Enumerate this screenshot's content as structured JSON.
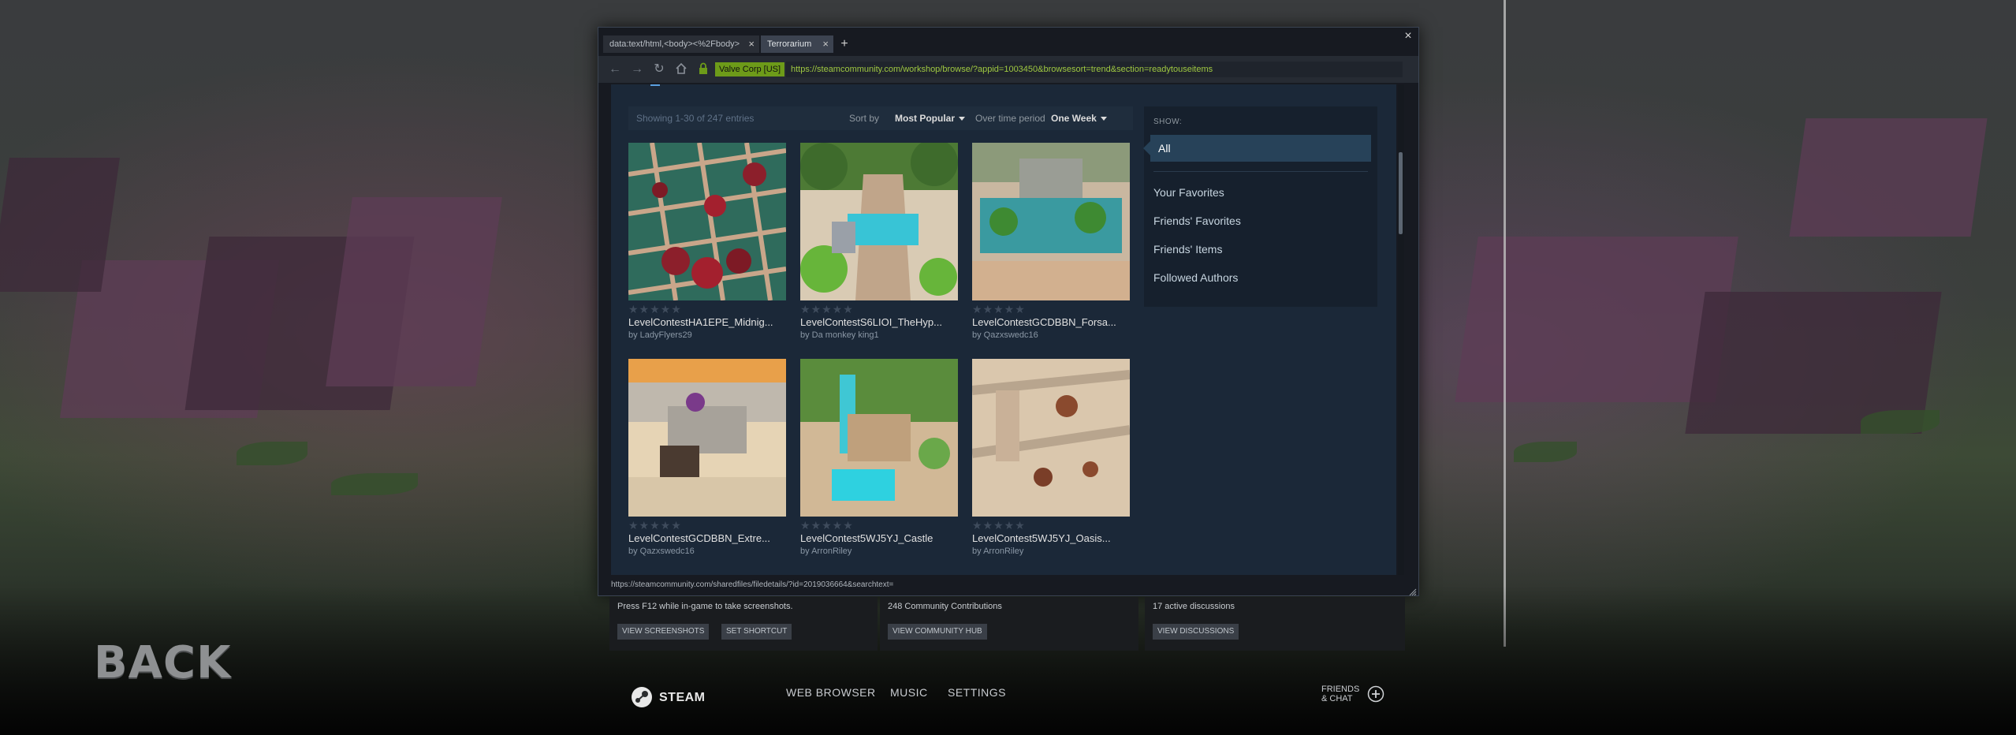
{
  "background": {
    "back_label": "BACK"
  },
  "browser": {
    "tabs": [
      {
        "label": "data:text/html,<body><%2Fbody>",
        "active": false
      },
      {
        "label": "Terrorarium",
        "active": true
      }
    ],
    "cert_label": "Valve Corp [US]",
    "url": "https://steamcommunity.com/workshop/browse/?appid=1003450&browsesort=trend&section=readytouseitems",
    "status_url": "https://steamcommunity.com/sharedfiles/filedetails/?id=2019036664&searchtext="
  },
  "workshop": {
    "showing": "Showing 1-30 of 247 entries",
    "sort_label": "Sort by",
    "sort_value": "Most Popular",
    "period_label": "Over time period",
    "period_value": "One Week",
    "items": [
      {
        "title": "LevelContestHA1EPE_Midnig...",
        "author": "by LadyFlyers29",
        "stars": "★★★★★"
      },
      {
        "title": "LevelContestS6LIOI_TheHyp...",
        "author": "by Da monkey king1",
        "stars": "★★★★★"
      },
      {
        "title": "LevelContestGCDBBN_Forsa...",
        "author": "by Qazxswedc16",
        "stars": "★★★★★"
      },
      {
        "title": "LevelContestGCDBBN_Extre...",
        "author": "by Qazxswedc16",
        "stars": "★★★★★"
      },
      {
        "title": "LevelContest5WJ5YJ_Castle",
        "author": "by ArronRiley",
        "stars": "★★★★★"
      },
      {
        "title": "LevelContest5WJ5YJ_Oasis...",
        "author": "by ArronRiley",
        "stars": "★★★★★"
      }
    ],
    "show_panel": {
      "header": "SHOW:",
      "selected": "All",
      "options": [
        "Your Favorites",
        "Friends' Favorites",
        "Friends' Items",
        "Followed Authors"
      ]
    }
  },
  "shortcuts": {
    "screenshots": {
      "text": "Press F12 while in-game to take screenshots.",
      "view_button": "VIEW SCREENSHOTS",
      "shortcut_button": "SET SHORTCUT"
    },
    "community": {
      "text": "248 Community Contributions",
      "button": "VIEW COMMUNITY HUB"
    },
    "discussions": {
      "text": "17 active discussions",
      "button": "VIEW DISCUSSIONS"
    }
  },
  "bottom_bar": {
    "steam_label": "STEAM",
    "web_browser": "WEB BROWSER",
    "music": "MUSIC",
    "settings": "SETTINGS",
    "friends_line1": "FRIENDS",
    "friends_line2": "& CHAT"
  },
  "icons": [
    "back-arrow-icon",
    "forward-arrow-icon",
    "reload-icon",
    "home-icon",
    "lock-icon",
    "close-icon",
    "new-tab-icon",
    "caret-down-icon",
    "star-icon",
    "resize-grip-icon",
    "steam-logo-icon",
    "friends-add-icon"
  ],
  "colors": {
    "accent_green": "#6d9b19",
    "url_green": "#9fc841",
    "workshop_bg": "#1b2838",
    "selected_filter": "#274259"
  }
}
